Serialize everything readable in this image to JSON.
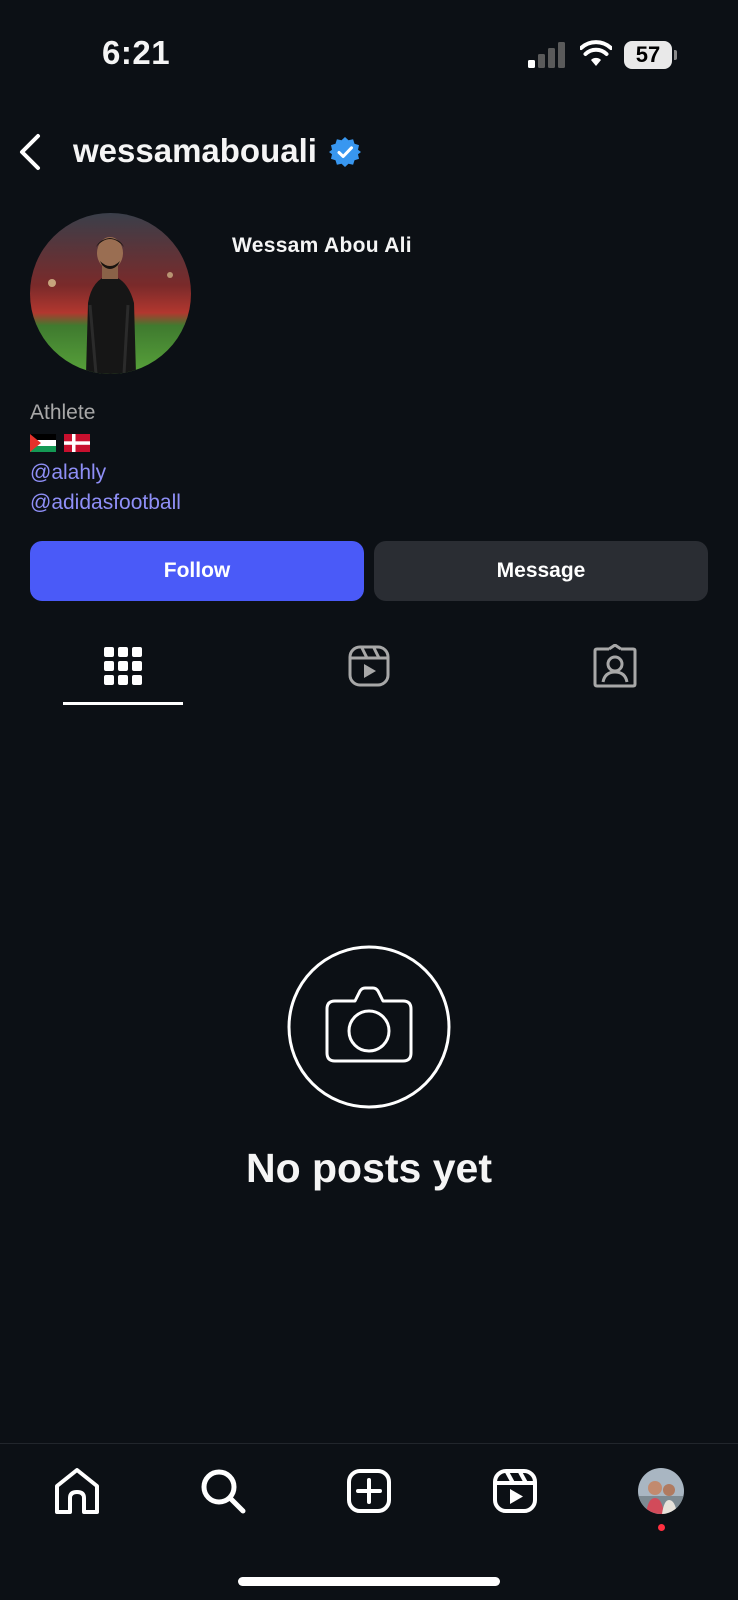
{
  "status_bar": {
    "time": "6:21",
    "battery": "57"
  },
  "header": {
    "username": "wessamabouali"
  },
  "profile": {
    "display_name": "Wessam Abou Ali",
    "category": "Athlete",
    "flags": [
      "palestine-flag",
      "denmark-flag"
    ],
    "links": [
      "@alahly",
      "@adidasfootball"
    ]
  },
  "actions": {
    "follow_label": "Follow",
    "message_label": "Message"
  },
  "tabs": [
    {
      "icon": "grid-icon",
      "active": true
    },
    {
      "icon": "reels-icon",
      "active": false
    },
    {
      "icon": "tagged-icon",
      "active": false
    }
  ],
  "empty_state": {
    "text": "No posts yet"
  },
  "bottom_nav": [
    "home-icon",
    "search-icon",
    "create-icon",
    "reels-icon",
    "profile-avatar"
  ],
  "colors": {
    "background": "#0c1015",
    "accent": "#4a5af8",
    "link": "#8f8ff7",
    "verified": "#3897f0",
    "notification_dot": "#ff3040"
  }
}
